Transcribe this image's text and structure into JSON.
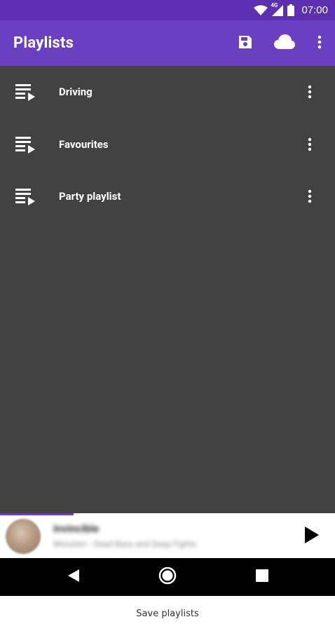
{
  "status_bar": {
    "time": "07:00",
    "network_label": "4G",
    "icons": [
      "wifi-icon",
      "signal-icon",
      "battery-icon"
    ]
  },
  "app_bar": {
    "title": "Playlists",
    "actions": [
      "save-icon",
      "cloud-icon",
      "more-vert-icon"
    ]
  },
  "playlists": [
    {
      "label": "Driving",
      "icon": "playlist-play-icon",
      "menu_icon": "more-vert-icon"
    },
    {
      "label": "Favourites",
      "icon": "playlist-play-icon",
      "menu_icon": "more-vert-icon"
    },
    {
      "label": "Party playlist",
      "icon": "playlist-play-icon",
      "menu_icon": "more-vert-icon"
    }
  ],
  "mini_player": {
    "title": "Invincible",
    "subtitle": "Monsterr - Dead Bass and Deep Fights",
    "progress_fraction": 0.22,
    "play_icon": "play-icon"
  },
  "nav_bar": {
    "icons": [
      "back-icon",
      "home-icon",
      "recents-icon"
    ]
  },
  "caption": "Save playlists",
  "colors": {
    "status_bar": "#5b2fb0",
    "app_bar": "#6a3fc0",
    "list_background": "#424242",
    "text_primary": "#ffffff"
  }
}
